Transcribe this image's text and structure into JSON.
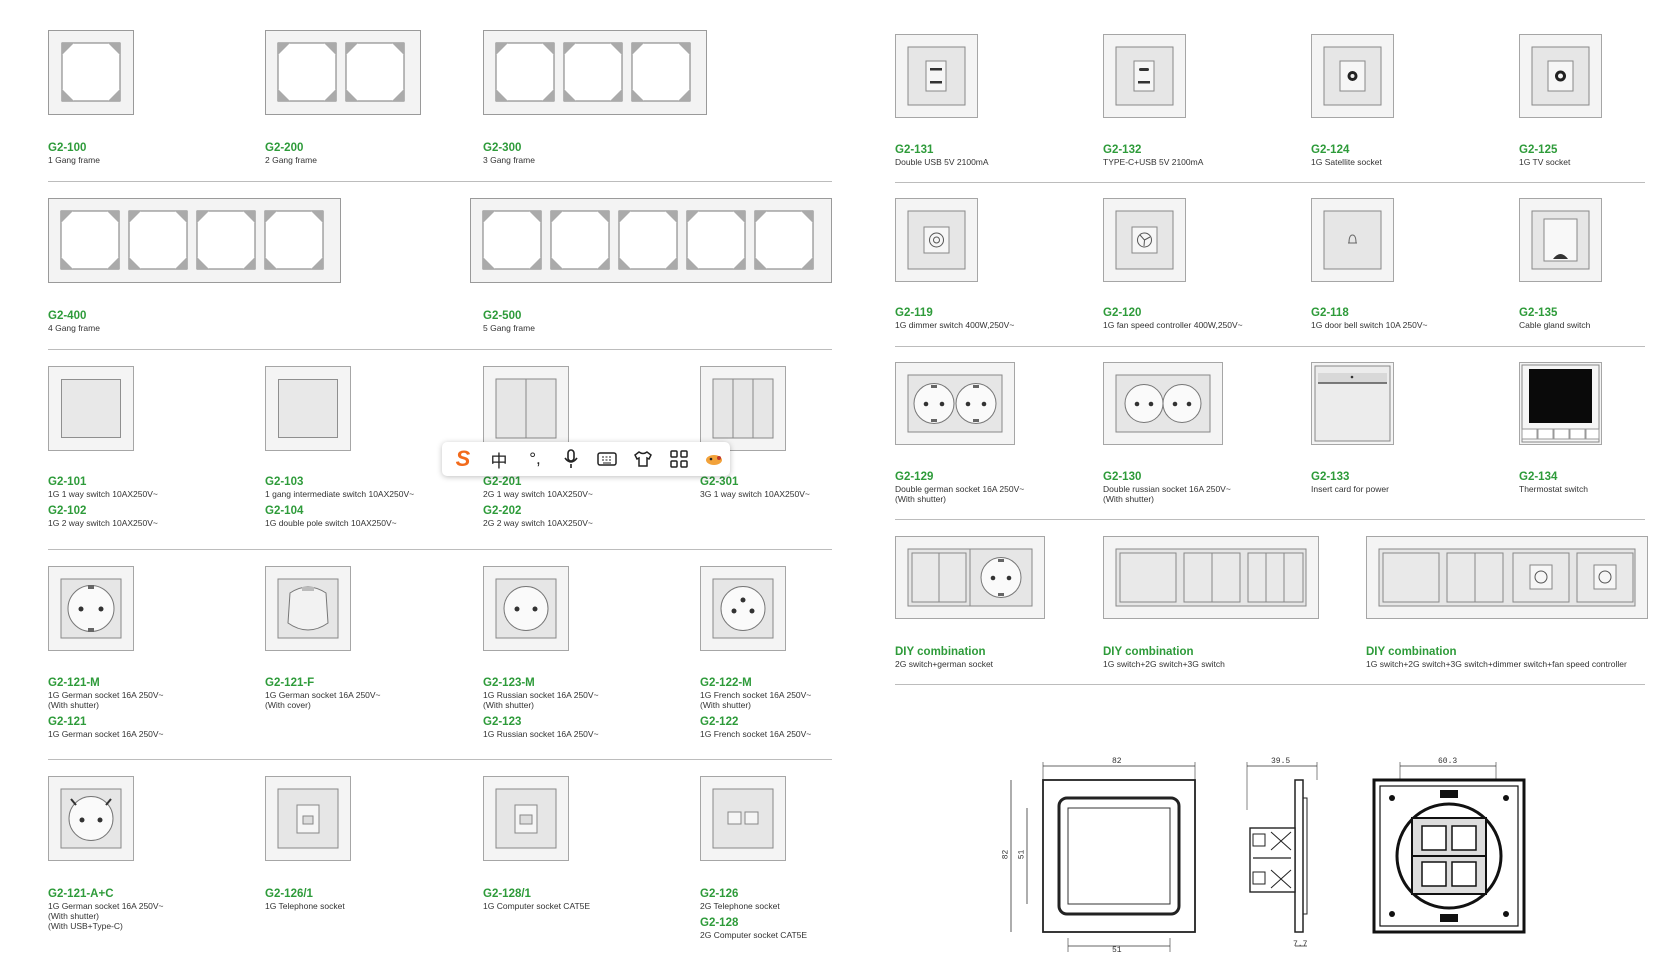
{
  "left": {
    "frames": [
      {
        "code": "G2-100",
        "desc": "1 Gang frame"
      },
      {
        "code": "G2-200",
        "desc": "2 Gang frame"
      },
      {
        "code": "G2-300",
        "desc": "3 Gang frame"
      },
      {
        "code": "G2-400",
        "desc": "4 Gang frame"
      },
      {
        "code": "G2-500",
        "desc": "5 Gang frame"
      }
    ],
    "switches": [
      {
        "code": "G2-101",
        "desc": "1G 1 way switch 10AX250V~",
        "code2": "G2-102",
        "desc2": "1G 2 way switch 10AX250V~"
      },
      {
        "code": "G2-103",
        "desc": "1 gang intermediate switch 10AX250V~",
        "code2": "G2-104",
        "desc2": "1G double pole switch 10AX250V~"
      },
      {
        "code": "G2-201",
        "desc": "2G 1 way  switch 10AX250V~",
        "code2": "G2-202",
        "desc2": "2G 2 way  switch 10AX250V~"
      },
      {
        "code": "G2-301",
        "desc": "3G 1 way  switch 10AX250V~"
      }
    ],
    "sockets": [
      {
        "code": "G2-121-M",
        "desc": "1G German socket 16A 250V~\n(With shutter)",
        "code2": "G2-121",
        "desc2": "1G German socket 16A 250V~"
      },
      {
        "code": "G2-121-F",
        "desc": "1G German socket 16A 250V~\n(With cover)"
      },
      {
        "code": "G2-123-M",
        "desc": "1G Russian socket 16A 250V~\n(With shutter)",
        "code2": "G2-123",
        "desc2": "1G Russian socket 16A 250V~"
      },
      {
        "code": "G2-122-M",
        "desc": "1G French socket 16A 250V~\n(With shutter)",
        "code2": "G2-122",
        "desc2": "1G French socket 16A 250V~"
      }
    ],
    "data": [
      {
        "code": "G2-121-A+C",
        "desc": "1G German socket 16A 250V~\n(With shutter)\n(With USB+Type-C)"
      },
      {
        "code": "G2-126/1",
        "desc": "1G Telephone socket"
      },
      {
        "code": "G2-128/1",
        "desc": "1G Computer socket CAT5E"
      },
      {
        "code": "G2-126",
        "desc": "2G Telephone socket",
        "code2": "G2-128",
        "desc2": "2G Computer socket CAT5E"
      }
    ]
  },
  "right": {
    "row1": [
      {
        "code": "G2-131",
        "desc": "Double USB 5V 2100mA"
      },
      {
        "code": "G2-132",
        "desc": "TYPE-C+USB  5V 2100mA"
      },
      {
        "code": "G2-124",
        "desc": "1G Satellite socket"
      },
      {
        "code": "G2-125",
        "desc": "1G TV socket"
      }
    ],
    "row2": [
      {
        "code": "G2-119",
        "desc": "1G dimmer switch 400W,250V~"
      },
      {
        "code": "G2-120",
        "desc": "1G fan speed controller 400W,250V~"
      },
      {
        "code": "G2-118",
        "desc": "1G door bell switch 10A 250V~"
      },
      {
        "code": "G2-135",
        "desc": "Cable gland switch"
      }
    ],
    "row3": [
      {
        "code": "G2-129",
        "desc": "Double german socket 16A 250V~\n(With shutter)"
      },
      {
        "code": "G2-130",
        "desc": "Double russian socket 16A 250V~\n(With shutter)"
      },
      {
        "code": "G2-133",
        "desc": "Insert card for power"
      },
      {
        "code": "G2-134",
        "desc": "Thermostat switch"
      }
    ],
    "diy": [
      {
        "code": "DIY combination",
        "desc": "2G switch+german socket"
      },
      {
        "code": "DIY combination",
        "desc": "1G switch+2G switch+3G switch"
      },
      {
        "code": "DIY combination",
        "desc": "1G switch+2G switch+3G switch+dimmer switch+fan speed controller"
      }
    ]
  },
  "drawing": {
    "dim_front_width": "82",
    "dim_front_height": "82",
    "dim_front_inner_h": "51",
    "dim_front_inner_w": "51",
    "dim_side_depth": "39.5",
    "dim_side_bottom": "7.7",
    "dim_back_width": "60.3"
  },
  "toolbar": {
    "icons": [
      "sogou-logo-icon",
      "chinese-mode-icon",
      "punctuation-icon",
      "microphone-icon",
      "keyboard-icon",
      "skin-icon",
      "apps-grid-icon",
      "pet-icon"
    ],
    "chinese_glyph": "中"
  },
  "colors": {
    "accent_green": "#2e9b3a",
    "line": "#bcbcbc"
  }
}
